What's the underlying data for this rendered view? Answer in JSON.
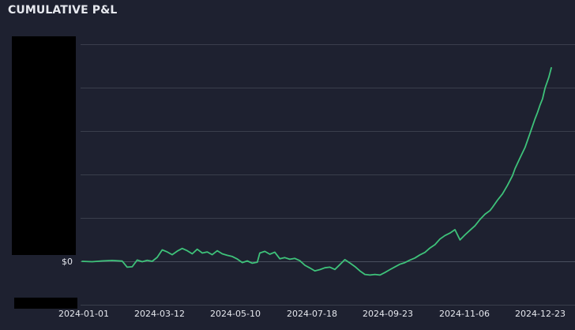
{
  "chart_data": {
    "type": "line",
    "title": "CUMULATIVE P&L",
    "xlabel": "",
    "ylabel": "",
    "x_tick_labels": [
      "2024-01-01",
      "2024-03-12",
      "2024-05-10",
      "2024-07-18",
      "2024-09-23",
      "2024-11-06",
      "2024-12-23"
    ],
    "y_tick_labels": [
      "$0"
    ],
    "grid": "horizontal",
    "legend": "none",
    "line_color": "#3ec27a",
    "series": [
      {
        "values": [
          [
            0,
            0.0
          ],
          [
            8,
            -0.2
          ],
          [
            16,
            0.2
          ],
          [
            24,
            0.4
          ],
          [
            32,
            0.1
          ],
          [
            36,
            -2.8
          ],
          [
            40,
            -2.6
          ],
          [
            44,
            0.6
          ],
          [
            48,
            -0.2
          ],
          [
            52,
            0.5
          ],
          [
            56,
            0.0
          ],
          [
            60,
            1.9
          ],
          [
            64,
            5.5
          ],
          [
            68,
            4.5
          ],
          [
            72,
            3.2
          ],
          [
            76,
            4.9
          ],
          [
            80,
            6.2
          ],
          [
            84,
            5.1
          ],
          [
            88,
            3.6
          ],
          [
            92,
            5.8
          ],
          [
            96,
            4.0
          ],
          [
            100,
            4.5
          ],
          [
            104,
            3.2
          ],
          [
            108,
            5.1
          ],
          [
            112,
            3.6
          ],
          [
            116,
            2.9
          ],
          [
            120,
            2.3
          ],
          [
            124,
            1.1
          ],
          [
            128,
            -0.6
          ],
          [
            132,
            0.2
          ],
          [
            136,
            -0.9
          ],
          [
            140,
            -0.4
          ],
          [
            142,
            4.0
          ],
          [
            146,
            4.8
          ],
          [
            150,
            3.4
          ],
          [
            154,
            4.4
          ],
          [
            158,
            1.2
          ],
          [
            162,
            1.8
          ],
          [
            166,
            1.0
          ],
          [
            170,
            1.4
          ],
          [
            174,
            0.3
          ],
          [
            178,
            -1.9
          ],
          [
            182,
            -3.2
          ],
          [
            186,
            -4.6
          ],
          [
            190,
            -4.0
          ],
          [
            194,
            -3.1
          ],
          [
            198,
            -2.8
          ],
          [
            202,
            -3.9
          ],
          [
            206,
            -1.6
          ],
          [
            210,
            0.8
          ],
          [
            214,
            -0.8
          ],
          [
            218,
            -2.5
          ],
          [
            222,
            -4.6
          ],
          [
            226,
            -6.3
          ],
          [
            230,
            -6.6
          ],
          [
            234,
            -6.3
          ],
          [
            238,
            -6.6
          ],
          [
            242,
            -5.4
          ],
          [
            246,
            -4.0
          ],
          [
            250,
            -2.7
          ],
          [
            254,
            -1.4
          ],
          [
            258,
            -0.6
          ],
          [
            262,
            0.6
          ],
          [
            266,
            1.6
          ],
          [
            270,
            3.1
          ],
          [
            274,
            4.3
          ],
          [
            278,
            6.4
          ],
          [
            282,
            8.0
          ],
          [
            286,
            10.7
          ],
          [
            290,
            12.4
          ],
          [
            294,
            13.6
          ],
          [
            298,
            15.2
          ],
          [
            302,
            10.3
          ],
          [
            306,
            12.7
          ],
          [
            310,
            14.9
          ],
          [
            314,
            17.1
          ],
          [
            318,
            20.1
          ],
          [
            322,
            22.6
          ],
          [
            326,
            24.4
          ],
          [
            328,
            26.0
          ],
          [
            332,
            29.4
          ],
          [
            336,
            32.4
          ],
          [
            340,
            36.6
          ],
          [
            344,
            41.2
          ],
          [
            346,
            44.6
          ],
          [
            350,
            49.7
          ],
          [
            354,
            54.7
          ],
          [
            358,
            61.6
          ],
          [
            362,
            68.5
          ],
          [
            364,
            71.6
          ],
          [
            366,
            75.1
          ],
          [
            368,
            78.1
          ],
          [
            370,
            83.3
          ],
          [
            373,
            88.4
          ],
          [
            375,
            93.0
          ]
        ]
      }
    ]
  }
}
